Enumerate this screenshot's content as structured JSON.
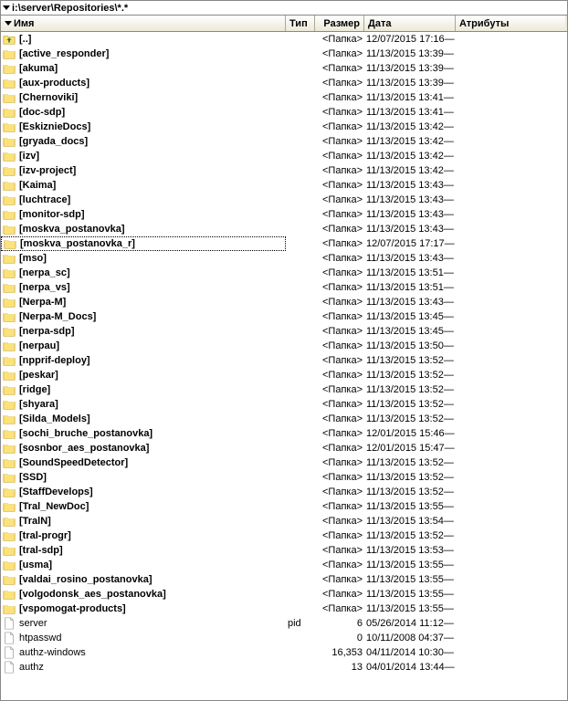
{
  "path": "i:\\server\\Repositories\\*.*",
  "columns": {
    "name": "Имя",
    "type": "Тип",
    "size": "Размер",
    "date": "Дата",
    "attr": "Атрибуты"
  },
  "size_folder_label": "<Папка>",
  "rows": [
    {
      "icon": "updir",
      "name": "[..]",
      "type": "",
      "size_label": "<Папка>",
      "date": "12/07/2015 17:16",
      "attr": "—",
      "selected": false
    },
    {
      "icon": "folder",
      "name": "[active_responder]",
      "type": "",
      "size_label": "<Папка>",
      "date": "11/13/2015 13:39",
      "attr": "—",
      "selected": false
    },
    {
      "icon": "folder",
      "name": "[akuma]",
      "type": "",
      "size_label": "<Папка>",
      "date": "11/13/2015 13:39",
      "attr": "—",
      "selected": false
    },
    {
      "icon": "folder",
      "name": "[aux-products]",
      "type": "",
      "size_label": "<Папка>",
      "date": "11/13/2015 13:39",
      "attr": "—",
      "selected": false
    },
    {
      "icon": "folder",
      "name": "[Chernoviki]",
      "type": "",
      "size_label": "<Папка>",
      "date": "11/13/2015 13:41",
      "attr": "—",
      "selected": false
    },
    {
      "icon": "folder",
      "name": "[doc-sdp]",
      "type": "",
      "size_label": "<Папка>",
      "date": "11/13/2015 13:41",
      "attr": "—",
      "selected": false
    },
    {
      "icon": "folder",
      "name": "[EskiznieDocs]",
      "type": "",
      "size_label": "<Папка>",
      "date": "11/13/2015 13:42",
      "attr": "—",
      "selected": false
    },
    {
      "icon": "folder",
      "name": "[gryada_docs]",
      "type": "",
      "size_label": "<Папка>",
      "date": "11/13/2015 13:42",
      "attr": "—",
      "selected": false
    },
    {
      "icon": "folder",
      "name": "[izv]",
      "type": "",
      "size_label": "<Папка>",
      "date": "11/13/2015 13:42",
      "attr": "—",
      "selected": false
    },
    {
      "icon": "folder",
      "name": "[izv-project]",
      "type": "",
      "size_label": "<Папка>",
      "date": "11/13/2015 13:42",
      "attr": "—",
      "selected": false
    },
    {
      "icon": "folder",
      "name": "[Kaima]",
      "type": "",
      "size_label": "<Папка>",
      "date": "11/13/2015 13:43",
      "attr": "—",
      "selected": false
    },
    {
      "icon": "folder",
      "name": "[luchtrace]",
      "type": "",
      "size_label": "<Папка>",
      "date": "11/13/2015 13:43",
      "attr": "—",
      "selected": false
    },
    {
      "icon": "folder",
      "name": "[monitor-sdp]",
      "type": "",
      "size_label": "<Папка>",
      "date": "11/13/2015 13:43",
      "attr": "—",
      "selected": false
    },
    {
      "icon": "folder",
      "name": "[moskva_postanovka]",
      "type": "",
      "size_label": "<Папка>",
      "date": "11/13/2015 13:43",
      "attr": "—",
      "selected": false
    },
    {
      "icon": "folder",
      "name": "[moskva_postanovka_r]",
      "type": "",
      "size_label": "<Папка>",
      "date": "12/07/2015 17:17",
      "attr": "—",
      "selected": true
    },
    {
      "icon": "folder",
      "name": "[mso]",
      "type": "",
      "size_label": "<Папка>",
      "date": "11/13/2015 13:43",
      "attr": "—",
      "selected": false
    },
    {
      "icon": "folder",
      "name": "[nerpa_sc]",
      "type": "",
      "size_label": "<Папка>",
      "date": "11/13/2015 13:51",
      "attr": "—",
      "selected": false
    },
    {
      "icon": "folder",
      "name": "[nerpa_vs]",
      "type": "",
      "size_label": "<Папка>",
      "date": "11/13/2015 13:51",
      "attr": "—",
      "selected": false
    },
    {
      "icon": "folder",
      "name": "[Nerpa-M]",
      "type": "",
      "size_label": "<Папка>",
      "date": "11/13/2015 13:43",
      "attr": "—",
      "selected": false
    },
    {
      "icon": "folder",
      "name": "[Nerpa-M_Docs]",
      "type": "",
      "size_label": "<Папка>",
      "date": "11/13/2015 13:45",
      "attr": "—",
      "selected": false
    },
    {
      "icon": "folder",
      "name": "[nerpa-sdp]",
      "type": "",
      "size_label": "<Папка>",
      "date": "11/13/2015 13:45",
      "attr": "—",
      "selected": false
    },
    {
      "icon": "folder",
      "name": "[nerpau]",
      "type": "",
      "size_label": "<Папка>",
      "date": "11/13/2015 13:50",
      "attr": "—",
      "selected": false
    },
    {
      "icon": "folder",
      "name": "[npprif-deploy]",
      "type": "",
      "size_label": "<Папка>",
      "date": "11/13/2015 13:52",
      "attr": "—",
      "selected": false
    },
    {
      "icon": "folder",
      "name": "[peskar]",
      "type": "",
      "size_label": "<Папка>",
      "date": "11/13/2015 13:52",
      "attr": "—",
      "selected": false
    },
    {
      "icon": "folder",
      "name": "[ridge]",
      "type": "",
      "size_label": "<Папка>",
      "date": "11/13/2015 13:52",
      "attr": "—",
      "selected": false
    },
    {
      "icon": "folder",
      "name": "[shyara]",
      "type": "",
      "size_label": "<Папка>",
      "date": "11/13/2015 13:52",
      "attr": "—",
      "selected": false
    },
    {
      "icon": "folder",
      "name": "[Silda_Models]",
      "type": "",
      "size_label": "<Папка>",
      "date": "11/13/2015 13:52",
      "attr": "—",
      "selected": false
    },
    {
      "icon": "folder",
      "name": "[sochi_bruche_postanovka]",
      "type": "",
      "size_label": "<Папка>",
      "date": "12/01/2015 15:46",
      "attr": "—",
      "selected": false
    },
    {
      "icon": "folder",
      "name": "[sosnbor_aes_postanovka]",
      "type": "",
      "size_label": "<Папка>",
      "date": "12/01/2015 15:47",
      "attr": "—",
      "selected": false
    },
    {
      "icon": "folder",
      "name": "[SoundSpeedDetector]",
      "type": "",
      "size_label": "<Папка>",
      "date": "11/13/2015 13:52",
      "attr": "—",
      "selected": false
    },
    {
      "icon": "folder",
      "name": "[SSD]",
      "type": "",
      "size_label": "<Папка>",
      "date": "11/13/2015 13:52",
      "attr": "—",
      "selected": false
    },
    {
      "icon": "folder",
      "name": "[StaffDevelops]",
      "type": "",
      "size_label": "<Папка>",
      "date": "11/13/2015 13:52",
      "attr": "—",
      "selected": false
    },
    {
      "icon": "folder",
      "name": "[Tral_NewDoc]",
      "type": "",
      "size_label": "<Папка>",
      "date": "11/13/2015 13:55",
      "attr": "—",
      "selected": false
    },
    {
      "icon": "folder",
      "name": "[TralN]",
      "type": "",
      "size_label": "<Папка>",
      "date": "11/13/2015 13:54",
      "attr": "—",
      "selected": false
    },
    {
      "icon": "folder",
      "name": "[tral-progr]",
      "type": "",
      "size_label": "<Папка>",
      "date": "11/13/2015 13:52",
      "attr": "—",
      "selected": false
    },
    {
      "icon": "folder",
      "name": "[tral-sdp]",
      "type": "",
      "size_label": "<Папка>",
      "date": "11/13/2015 13:53",
      "attr": "—",
      "selected": false
    },
    {
      "icon": "folder",
      "name": "[usma]",
      "type": "",
      "size_label": "<Папка>",
      "date": "11/13/2015 13:55",
      "attr": "—",
      "selected": false
    },
    {
      "icon": "folder",
      "name": "[valdai_rosino_postanovka]",
      "type": "",
      "size_label": "<Папка>",
      "date": "11/13/2015 13:55",
      "attr": "—",
      "selected": false
    },
    {
      "icon": "folder",
      "name": "[volgodonsk_aes_postanovka]",
      "type": "",
      "size_label": "<Папка>",
      "date": "11/13/2015 13:55",
      "attr": "—",
      "selected": false
    },
    {
      "icon": "folder",
      "name": "[vspomogat-products]",
      "type": "",
      "size_label": "<Папка>",
      "date": "11/13/2015 13:55",
      "attr": "—",
      "selected": false
    },
    {
      "icon": "file",
      "name": "server",
      "type": "pid",
      "size_label": "6",
      "date": "05/26/2014 11:12",
      "attr": "—",
      "selected": false
    },
    {
      "icon": "file",
      "name": "htpasswd",
      "type": "",
      "size_label": "0",
      "date": "10/11/2008 04:37",
      "attr": "—",
      "selected": false
    },
    {
      "icon": "file",
      "name": "authz-windows",
      "type": "",
      "size_label": "16,353",
      "date": "04/11/2014 10:30",
      "attr": "—",
      "selected": false
    },
    {
      "icon": "file",
      "name": "authz",
      "type": "",
      "size_label": "13",
      "date": "04/01/2014 13:44",
      "attr": "—",
      "selected": false
    }
  ]
}
